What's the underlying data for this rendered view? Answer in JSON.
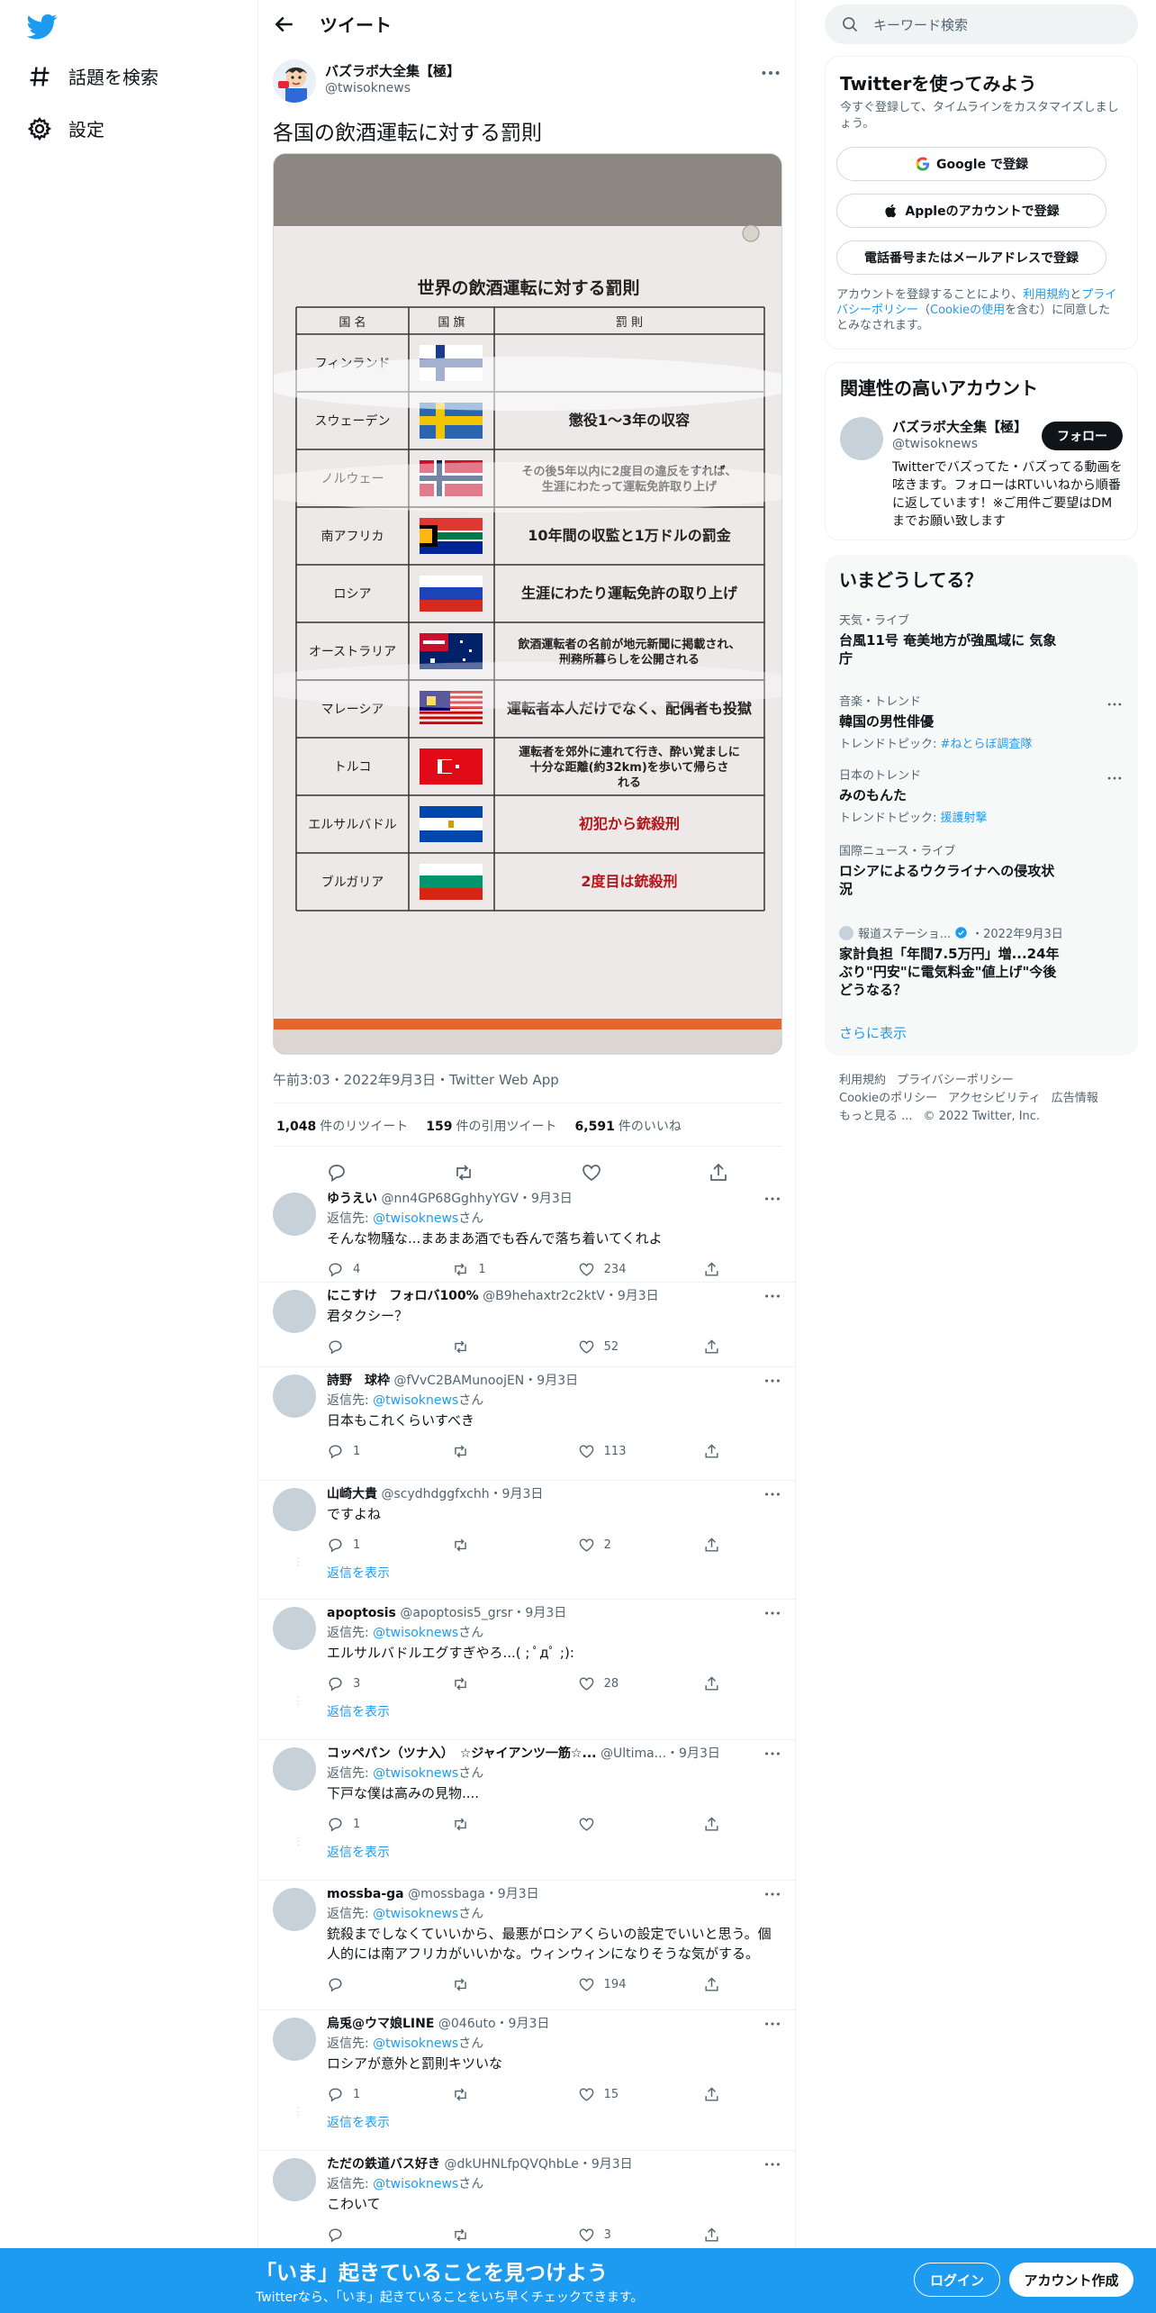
{
  "nav": {
    "explore": "話題を検索",
    "settings": "設定"
  },
  "header": {
    "title": "ツイート"
  },
  "tweet": {
    "name": "バズラボ大全集【極】",
    "handle": "@twisoknews",
    "text": "各国の飲酒運転に対する罰則",
    "meta": "午前3:03・2022年9月3日・Twitter Web App",
    "retweets": "1,048",
    "retweets_label": "件のリツイート",
    "quotes": "159",
    "quotes_label": "件の引用ツイート",
    "likes": "6,591",
    "likes_label": "件のいいね"
  },
  "photo": {
    "title": "世界の飲酒運転に対する罰則",
    "headers": [
      "国 名",
      "国 旗",
      "罰 則"
    ],
    "rows": [
      {
        "country": "フィンランド",
        "penalty": ""
      },
      {
        "country": "スウェーデン",
        "penalty": "懲役1～3年の収容"
      },
      {
        "country": "ノルウェー",
        "penalty": "その後5年以内に2度目の違反をすれば、生涯にわたって運転免許取り上げ"
      },
      {
        "country": "南アフリカ",
        "penalty": "10年間の収監と1万ドルの罰金"
      },
      {
        "country": "ロシア",
        "penalty": "生涯にわたり運転免許の取り上げ"
      },
      {
        "country": "オーストラリア",
        "penalty": "飲酒運転者の名前が地元新聞に掲載され、刑務所暮らしを公開される"
      },
      {
        "country": "マレーシア",
        "penalty": "運転者本人だけでなく、配偶者も投獄"
      },
      {
        "country": "トルコ",
        "penalty": "運転者を郊外に連れて行き、酔い覚ましに十分な距離(約32km)を歩いて帰らされる"
      },
      {
        "country": "エルサルバドル",
        "penalty": "初犯から銃殺刑"
      },
      {
        "country": "ブルガリア",
        "penalty": "2度目は銃殺刑"
      }
    ]
  },
  "replies": [
    {
      "name": "ゆうえい",
      "handle": "@nn4GP68GghhyYGV",
      "date": "・9月3日",
      "to_label": "返信先:",
      "to": "@twisoknews",
      "to_suffix": "さん",
      "text": "そんな物騒な...まあまあ酒でも呑んで落ち着いてくれよ",
      "replies": "4",
      "retweets": "1",
      "likes": "234",
      "show": ""
    },
    {
      "name": "にこすけ　フォロバ100%",
      "handle": "@B9hehaxtr2c2ktV",
      "date": "・9月3日",
      "to_label": "",
      "to": "",
      "to_suffix": "",
      "text": "君タクシー？",
      "replies": "",
      "retweets": "",
      "likes": "52",
      "show": ""
    },
    {
      "name": "詩野　球枠",
      "handle": "@fVvC2BAMunoojEN",
      "date": "・9月3日",
      "to_label": "返信先:",
      "to": "@twisoknews",
      "to_suffix": "さん",
      "text": "日本もこれくらいすべき",
      "replies": "1",
      "retweets": "",
      "likes": "113",
      "show": ""
    },
    {
      "name": "山崎大貴",
      "handle": "@scydhdggfxchh",
      "date": "・9月3日",
      "to_label": "",
      "to": "",
      "to_suffix": "",
      "text": "ですよね",
      "replies": "1",
      "retweets": "",
      "likes": "2",
      "show": "返信を表示"
    },
    {
      "name": "apoptosis",
      "handle": "@apoptosis5_grsr",
      "date": "・9月3日",
      "to_label": "返信先:",
      "to": "@twisoknews",
      "to_suffix": "さん",
      "text": "エルサルバドルエグすぎやろ...( ; ﾟдﾟ ;):",
      "replies": "3",
      "retweets": "",
      "likes": "28",
      "show": "返信を表示"
    },
    {
      "name": "コッペパン（ツナ入）　☆ジャイアンツ一筋☆...",
      "handle": "@Ultima...",
      "date": "・9月3日",
      "to_label": "返信先:",
      "to": "@twisoknews",
      "to_suffix": "さん",
      "text": "下戸な僕は高みの見物....",
      "replies": "1",
      "retweets": "",
      "likes": "",
      "show": "返信を表示"
    },
    {
      "name": "mossba-ga",
      "handle": "@mossbaga",
      "date": "・9月3日",
      "to_label": "返信先:",
      "to": "@twisoknews",
      "to_suffix": "さん",
      "text": "銃殺までしなくていいから、最悪がロシアくらいの設定でいいと思う。個人的には南アフリカがいいかな。ウィンウィンになりそうな気がする。",
      "replies": "",
      "retweets": "",
      "likes": "194",
      "show": ""
    },
    {
      "name": "烏兎@ウマ娘LINE",
      "handle": "@046uto",
      "date": "・9月3日",
      "to_label": "返信先:",
      "to": "@twisoknews",
      "to_suffix": "さん",
      "text": "ロシアが意外と罰則キツいな",
      "replies": "1",
      "retweets": "",
      "likes": "15",
      "show": "返信を表示"
    },
    {
      "name": "ただの鉄道バス好き",
      "handle": "@dkUHNLfpQVQhbLe",
      "date": "・9月3日",
      "to_label": "返信先:",
      "to": "@twisoknews",
      "to_suffix": "さん",
      "text": "こわいて",
      "replies": "",
      "retweets": "",
      "likes": "3",
      "show": ""
    }
  ],
  "right": {
    "search_placeholder": "キーワード検索",
    "join_title": "Twitterを使ってみよう",
    "join_sub": "今すぐ登録して、タイムラインをカスタマイズしましょう。",
    "google_btn": "Google で登録",
    "apple_btn": "Appleのアカウントで登録",
    "phone_btn": "電話番号またはメールアドレスで登録",
    "legal_1": "アカウントを登録することにより、",
    "legal_terms": "利用規約",
    "legal_and": "と",
    "legal_privacy": "プライバシーポリシー",
    "legal_cookie_open": "（",
    "legal_cookie": "Cookieの使用",
    "legal_2": "を含む）に同意したとみなされます。",
    "related_title": "関連性の高いアカウント",
    "related_name": "バズラボ大全集【極】",
    "related_handle": "@twisoknews",
    "follow_btn": "フォロー",
    "related_bio": "Twitterでバズってた・バズってる動画を呟きます。フォローはRTいいねから順番に返しています！※ご用件ご要望はDMまでお願い致します",
    "trends_title": "いまどうしてる？",
    "trends": [
      {
        "ctx": "天気・ライブ",
        "name": "台風11号 奄美地方が強風域に 気象庁",
        "sub_label": "",
        "sub_link": ""
      },
      {
        "ctx": "音楽・トレンド",
        "name": "韓国の男性俳優",
        "sub_label": "トレンドトピック: ",
        "sub_link": "#ねとらぼ調査隊"
      },
      {
        "ctx": "日本のトレンド",
        "name": "みのもんた",
        "sub_label": "トレンドトピック: ",
        "sub_link": "援護射撃"
      },
      {
        "ctx": "国際ニュース・ライブ",
        "name": "ロシアによるウクライナへの侵攻状況",
        "sub_label": "",
        "sub_link": ""
      }
    ],
    "news_source": "報道ステーショ...",
    "news_date": "・2022年9月3日",
    "news_title": "家計負担「年間7.5万円」増...24年ぶり\"円安\"に電気料金\"値上げ\"今後どうなる？",
    "show_more": "さらに表示",
    "footer_links": [
      "利用規約",
      "プライバシーポリシー",
      "Cookieのポリシー",
      "アクセシビリティ",
      "広告情報",
      "もっと見る ...",
      "© 2022 Twitter, Inc."
    ]
  },
  "bottom": {
    "title": "「いま」起きていることを見つけよう",
    "sub": "Twitterなら、「いま」起きていることをいち早くチェックできます。",
    "login": "ログイン",
    "signup": "アカウント作成"
  },
  "colors": {
    "brand": "#1d9bf0",
    "text": "#0f1419",
    "secondary": "#536471"
  }
}
